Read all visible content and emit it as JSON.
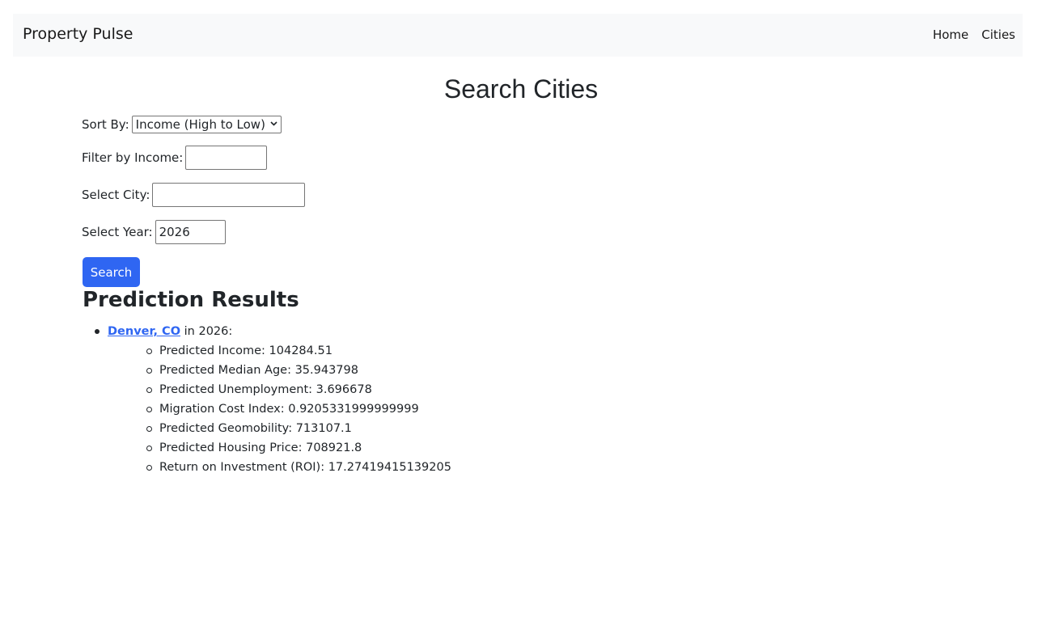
{
  "navbar": {
    "brand": "Property Pulse",
    "links": [
      "Home",
      "Cities"
    ]
  },
  "page_title": "Search Cities",
  "form": {
    "sort": {
      "label": "Sort By:",
      "selected": "Income (High to Low)"
    },
    "income": {
      "label": "Filter by Income:",
      "value": ""
    },
    "city": {
      "label": "Select City:",
      "value": ""
    },
    "year": {
      "label": "Select Year:",
      "value": "2026"
    },
    "search_label": "Search"
  },
  "results": {
    "title": "Prediction Results",
    "items": [
      {
        "city": "Denver, CO",
        "suffix": "in 2026:",
        "details": [
          "Predicted Income: 104284.51",
          "Predicted Median Age: 35.943798",
          "Predicted Unemployment: 3.696678",
          "Migration Cost Index: 0.9205331999999999",
          "Predicted Geomobility: 713107.1",
          "Predicted Housing Price: 708921.8",
          "Return on Investment (ROI): 17.27419415139205"
        ]
      }
    ]
  },
  "colors": {
    "accent": "#2f66f2",
    "navbar_bg": "#f8f9fa",
    "text": "#212529"
  }
}
